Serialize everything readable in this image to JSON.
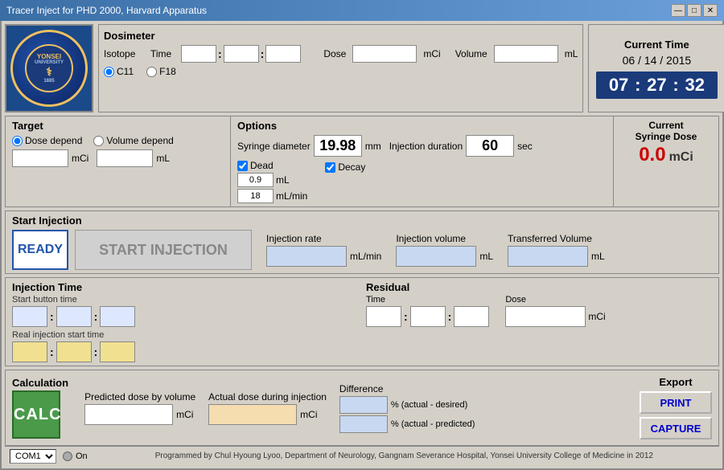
{
  "window": {
    "title": "Tracer Inject for PHD 2000, Harvard Apparatus"
  },
  "titlebar_buttons": {
    "minimize": "—",
    "maximize": "□",
    "close": "✕"
  },
  "dosimeter": {
    "title": "Dosimeter",
    "isotope_label": "Isotope",
    "time_label": "Time",
    "isotope_c11": "C11",
    "isotope_f18": "F18",
    "dose_label": "Dose",
    "volume_label": "Volume",
    "mci": "mCi",
    "ml": "mL"
  },
  "current_time": {
    "title": "Current Time",
    "date": "06 / 14 / 2015",
    "hour": "07",
    "minute": "27",
    "second": "32"
  },
  "target": {
    "title": "Target",
    "dose_depend": "Dose depend",
    "volume_depend": "Volume depend",
    "mci": "mCi",
    "ml": "mL"
  },
  "options": {
    "title": "Options",
    "syringe_diameter_label": "Syringe diameter",
    "syringe_diameter_value": "19.98",
    "syringe_diameter_unit": "mm",
    "injection_duration_label": "Injection duration",
    "injection_duration_value": "60",
    "injection_duration_unit": "sec",
    "dead_label": "Dead",
    "dead_val1": "0.9",
    "dead_unit1": "mL",
    "dead_val2": "18",
    "dead_unit2": "mL/min",
    "decay_label": "Decay"
  },
  "current_syringe": {
    "title": "Current",
    "subtitle": "Syringe Dose",
    "value": "0.0",
    "unit": "mCi"
  },
  "start_injection": {
    "title": "Start Injection",
    "ready_label": "READY",
    "start_label": "START INJECTION",
    "injection_rate_label": "Injection rate",
    "ml_min": "mL/min",
    "injection_volume_label": "Injection volume",
    "ml": "mL",
    "transferred_label": "Transferred Volume",
    "ml2": "mL"
  },
  "injection_time": {
    "title": "Injection Time",
    "start_button_label": "Start button time",
    "real_injection_label": "Real injection start time"
  },
  "residual": {
    "title": "Residual",
    "time_label": "Time",
    "dose_label": "Dose",
    "mci": "mCi"
  },
  "calculation": {
    "title": "Calculation",
    "calc_btn": "CALC",
    "predicted_label": "Predicted dose by volume",
    "mci1": "mCi",
    "actual_label": "Actual dose during injection",
    "mci2": "mCi",
    "difference_label": "Difference",
    "diff1_label": "% (actual - desired)",
    "diff2_label": "% (actual - predicted)"
  },
  "export": {
    "title": "Export",
    "print_label": "PRINT",
    "capture_label": "CAPTURE"
  },
  "statusbar": {
    "com_label": "COM1",
    "on_label": "On",
    "status_text": "Programmed by Chul Hyoung Lyoo, Department of Neurology, Gangnam Severance Hospital, Yonsei University College of Medicine in 2012"
  }
}
